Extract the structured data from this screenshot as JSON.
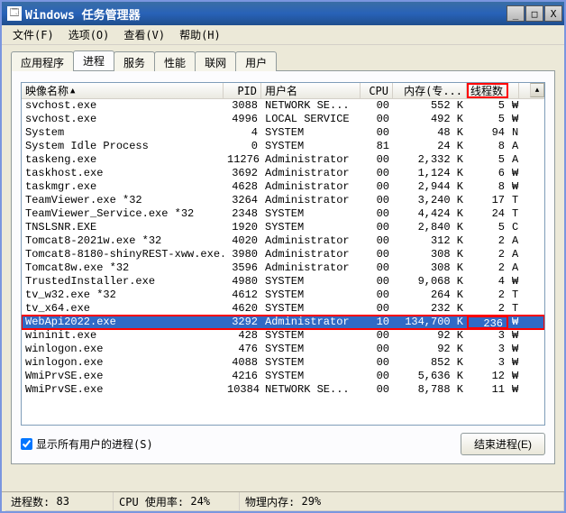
{
  "title": "Windows 任务管理器",
  "winbuttons": {
    "min": "_",
    "max": "□",
    "close": "X"
  },
  "menu": [
    "文件(F)",
    "选项(O)",
    "查看(V)",
    "帮助(H)"
  ],
  "tabs": [
    "应用程序",
    "进程",
    "服务",
    "性能",
    "联网",
    "用户"
  ],
  "activeTab": "进程",
  "columns": {
    "name": "映像名称",
    "pid": "PID",
    "user": "用户名",
    "cpu": "CPU",
    "mem": "内存(专...",
    "threads": "线程数"
  },
  "rows": [
    {
      "name": "svchost.exe",
      "pid": "3088",
      "user": "NETWORK SE...",
      "cpu": "00",
      "mem": "552 K",
      "threads": "5",
      "sel": false,
      "ext": "₩"
    },
    {
      "name": "svchost.exe",
      "pid": "4996",
      "user": "LOCAL SERVICE",
      "cpu": "00",
      "mem": "492 K",
      "threads": "5",
      "sel": false,
      "ext": "₩"
    },
    {
      "name": "System",
      "pid": "4",
      "user": "SYSTEM",
      "cpu": "00",
      "mem": "48 K",
      "threads": "94",
      "sel": false,
      "ext": "N"
    },
    {
      "name": "System Idle Process",
      "pid": "0",
      "user": "SYSTEM",
      "cpu": "81",
      "mem": "24 K",
      "threads": "8",
      "sel": false,
      "ext": "A"
    },
    {
      "name": "taskeng.exe",
      "pid": "11276",
      "user": "Administrator",
      "cpu": "00",
      "mem": "2,332 K",
      "threads": "5",
      "sel": false,
      "ext": "A"
    },
    {
      "name": "taskhost.exe",
      "pid": "3692",
      "user": "Administrator",
      "cpu": "00",
      "mem": "1,124 K",
      "threads": "6",
      "sel": false,
      "ext": "₩"
    },
    {
      "name": "taskmgr.exe",
      "pid": "4628",
      "user": "Administrator",
      "cpu": "00",
      "mem": "2,944 K",
      "threads": "8",
      "sel": false,
      "ext": "₩"
    },
    {
      "name": "TeamViewer.exe *32",
      "pid": "3264",
      "user": "Administrator",
      "cpu": "00",
      "mem": "3,240 K",
      "threads": "17",
      "sel": false,
      "ext": "T"
    },
    {
      "name": "TeamViewer_Service.exe *32",
      "pid": "2348",
      "user": "SYSTEM",
      "cpu": "00",
      "mem": "4,424 K",
      "threads": "24",
      "sel": false,
      "ext": "T"
    },
    {
      "name": "TNSLSNR.EXE",
      "pid": "1920",
      "user": "SYSTEM",
      "cpu": "00",
      "mem": "2,840 K",
      "threads": "5",
      "sel": false,
      "ext": "C"
    },
    {
      "name": "Tomcat8-2021w.exe *32",
      "pid": "4020",
      "user": "Administrator",
      "cpu": "00",
      "mem": "312 K",
      "threads": "2",
      "sel": false,
      "ext": "A"
    },
    {
      "name": "Tomcat8-8180-shinyREST-xww.exe...",
      "pid": "3980",
      "user": "Administrator",
      "cpu": "00",
      "mem": "308 K",
      "threads": "2",
      "sel": false,
      "ext": "A"
    },
    {
      "name": "Tomcat8w.exe *32",
      "pid": "3596",
      "user": "Administrator",
      "cpu": "00",
      "mem": "308 K",
      "threads": "2",
      "sel": false,
      "ext": "A"
    },
    {
      "name": "TrustedInstaller.exe",
      "pid": "4980",
      "user": "SYSTEM",
      "cpu": "00",
      "mem": "9,068 K",
      "threads": "4",
      "sel": false,
      "ext": "₩"
    },
    {
      "name": "tv_w32.exe *32",
      "pid": "4612",
      "user": "SYSTEM",
      "cpu": "00",
      "mem": "264 K",
      "threads": "2",
      "sel": false,
      "ext": "T"
    },
    {
      "name": "tv_x64.exe",
      "pid": "4620",
      "user": "SYSTEM",
      "cpu": "00",
      "mem": "232 K",
      "threads": "2",
      "sel": false,
      "ext": "T"
    },
    {
      "name": "WebApi2022.exe",
      "pid": "3292",
      "user": "Administrator",
      "cpu": "10",
      "mem": "134,700 K",
      "threads": "236",
      "sel": true,
      "ext": "₩"
    },
    {
      "name": "wininit.exe",
      "pid": "428",
      "user": "SYSTEM",
      "cpu": "00",
      "mem": "92 K",
      "threads": "3",
      "sel": false,
      "ext": "₩"
    },
    {
      "name": "winlogon.exe",
      "pid": "476",
      "user": "SYSTEM",
      "cpu": "00",
      "mem": "92 K",
      "threads": "3",
      "sel": false,
      "ext": "₩"
    },
    {
      "name": "winlogon.exe",
      "pid": "4088",
      "user": "SYSTEM",
      "cpu": "00",
      "mem": "852 K",
      "threads": "3",
      "sel": false,
      "ext": "₩"
    },
    {
      "name": "WmiPrvSE.exe",
      "pid": "4216",
      "user": "SYSTEM",
      "cpu": "00",
      "mem": "5,636 K",
      "threads": "12",
      "sel": false,
      "ext": "₩"
    },
    {
      "name": "WmiPrvSE.exe",
      "pid": "10384",
      "user": "NETWORK SE...",
      "cpu": "00",
      "mem": "8,788 K",
      "threads": "11",
      "sel": false,
      "ext": "₩"
    }
  ],
  "showAllUsers": "显示所有用户的进程(S)",
  "showAllUsersChecked": true,
  "endProcess": "结束进程(E)",
  "status": {
    "procs_label": "进程数:",
    "procs_value": "83",
    "cpu_label": "CPU 使用率:",
    "cpu_value": "24%",
    "mem_label": "物理内存:",
    "mem_value": "29%"
  }
}
